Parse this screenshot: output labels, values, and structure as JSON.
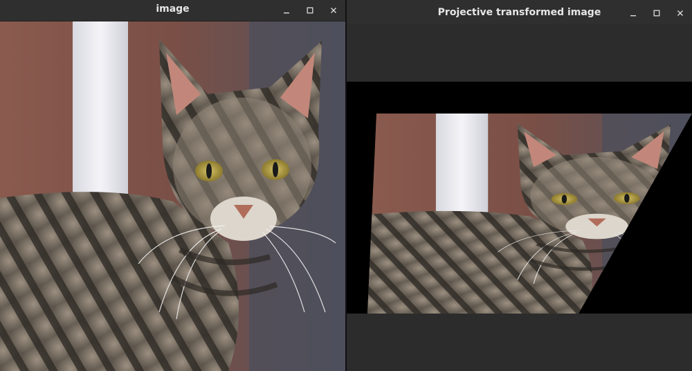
{
  "windows": [
    {
      "title": "image",
      "controls": {
        "minimize": "minimize",
        "maximize": "maximize",
        "close": "close"
      }
    },
    {
      "title": "Projective transformed image",
      "controls": {
        "minimize": "minimize",
        "maximize": "maximize",
        "close": "close"
      }
    }
  ],
  "icons": [
    "minimize-icon",
    "maximize-icon",
    "close-icon"
  ],
  "colors": {
    "window_bg": "#2c2c2c",
    "titlebar_bg": "#2f2f2f",
    "title_text": "#e6e6e6",
    "transform_fill": "#000000"
  }
}
